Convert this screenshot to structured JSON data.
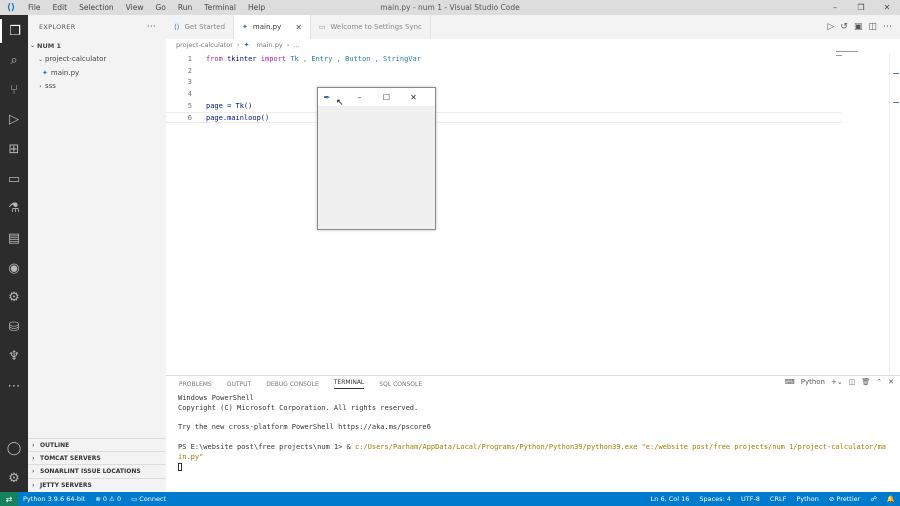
{
  "titlebar": {
    "menu": [
      "File",
      "Edit",
      "Selection",
      "View",
      "Go",
      "Run",
      "Terminal",
      "Help"
    ],
    "title": "main.py - num 1 - Visual Studio Code"
  },
  "sidebar": {
    "header": "EXPLORER",
    "folder": "NUM 1",
    "tree": [
      {
        "label": "project-calculator",
        "type": "folder-open"
      },
      {
        "label": "main.py",
        "type": "python-file"
      },
      {
        "label": "sss",
        "type": "folder-closed"
      }
    ],
    "sections": [
      "OUTLINE",
      "TOMCAT SERVERS",
      "SONARLINT ISSUE LOCATIONS",
      "JETTY SERVERS"
    ]
  },
  "tabs": [
    {
      "label": "Get Started",
      "icon": "vscode-icon"
    },
    {
      "label": "main.py",
      "icon": "python-icon",
      "active": true
    },
    {
      "label": "Welcome to Settings Sync",
      "icon": "file-icon"
    }
  ],
  "breadcrumb": [
    "project-calculator",
    "main.py",
    "..."
  ],
  "code": {
    "line1": {
      "n": "1",
      "from": "from",
      "mod": " tkinter ",
      "import": "import",
      "names": " Tk , Entry , Button , StringVar"
    },
    "line2": {
      "n": "2"
    },
    "line3": {
      "n": "3"
    },
    "line4": {
      "n": "4"
    },
    "line5": {
      "n": "5",
      "text": "page = Tk()"
    },
    "line6": {
      "n": "6",
      "text": "page.mainloop()"
    }
  },
  "tkwindow": {
    "icon": "tk-feather-icon",
    "controls": [
      "–",
      "☐",
      "✕"
    ]
  },
  "panel": {
    "tabs": [
      "PROBLEMS",
      "OUTPUT",
      "DEBUG CONSOLE",
      "TERMINAL",
      "SQL CONSOLE"
    ],
    "shell": "Python",
    "terminal": {
      "l1": "Windows PowerShell",
      "l2": "Copyright (C) Microsoft Corporation. All rights reserved.",
      "l3": "Try the new cross-platform PowerShell https://aka.ms/pscore6",
      "prompt": "PS E:\\website post\\free projects\\num 1> & ",
      "cmd": "c:/Users/Parham/AppData/Local/Programs/Python/Python39/python39.exe \"e:/website post/free projects/num 1/project-calculator/ma",
      "cmd2": "in.py\""
    }
  },
  "status": {
    "python": "Python 3.9.6 64-bit",
    "errors": "0",
    "warnings": "0",
    "connect": "Connect",
    "position": "Ln 6, Col 16",
    "spaces": "Spaces: 4",
    "encoding": "UTF-8",
    "eol": "CRLF",
    "language": "Python",
    "prettier": "Prettier"
  }
}
